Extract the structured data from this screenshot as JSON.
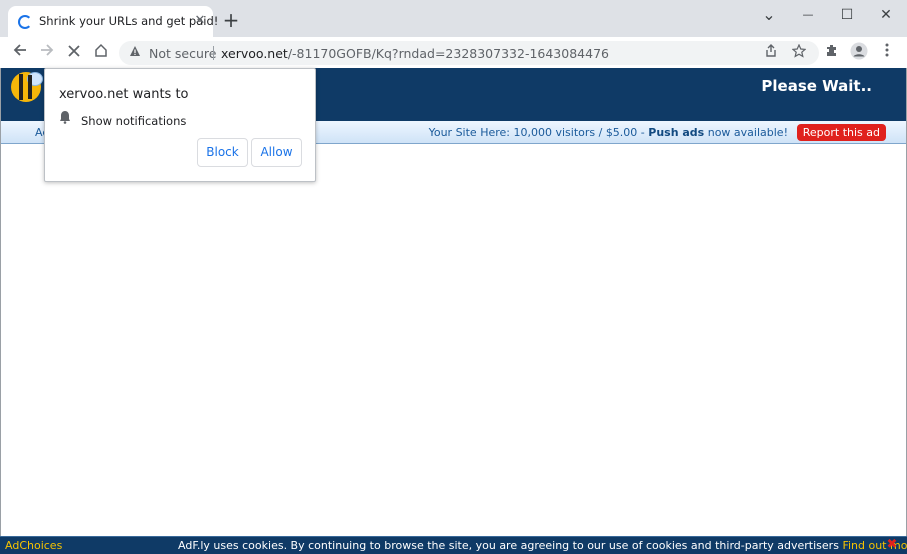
{
  "browser": {
    "tab_title": "Shrink your URLs and get paid!",
    "tab_close": "✕",
    "new_tab": "+",
    "window_controls": {
      "minimize": "⌄",
      "restore": "—",
      "maximize": "☐",
      "close": "✕"
    },
    "security_label": "Not secure",
    "url_domain": "xervoo.net",
    "url_path": "/-81170GOFB/Kq?rndad=2328307332-1643084476"
  },
  "site": {
    "header_status": "Please Wait..",
    "adbar_left": "Ac",
    "adbar_prefix": "Your Site Here: 10,000 visitors / $5.00 - ",
    "adbar_bold": "Push ads",
    "adbar_suffix": " now available!",
    "report_button": "Report this ad"
  },
  "permission_popup": {
    "title": "xervoo.net wants to",
    "message": "Show notifications",
    "block_label": "Block",
    "allow_label": "Allow"
  },
  "cookie_bar": {
    "adchoices": "AdChoices",
    "text": "AdF.ly uses cookies. By continuing to browse the site, you are agreeing to our use of cookies and third-party advertisers ",
    "link": "Find out more.",
    "close": "✖"
  },
  "icons": [
    "loading-spinner-icon",
    "back-icon",
    "forward-icon",
    "stop-icon",
    "home-icon",
    "warning-icon",
    "share-icon",
    "star-icon",
    "extensions-icon",
    "profile-icon",
    "menu-icon",
    "bell-icon",
    "bee-logo"
  ]
}
